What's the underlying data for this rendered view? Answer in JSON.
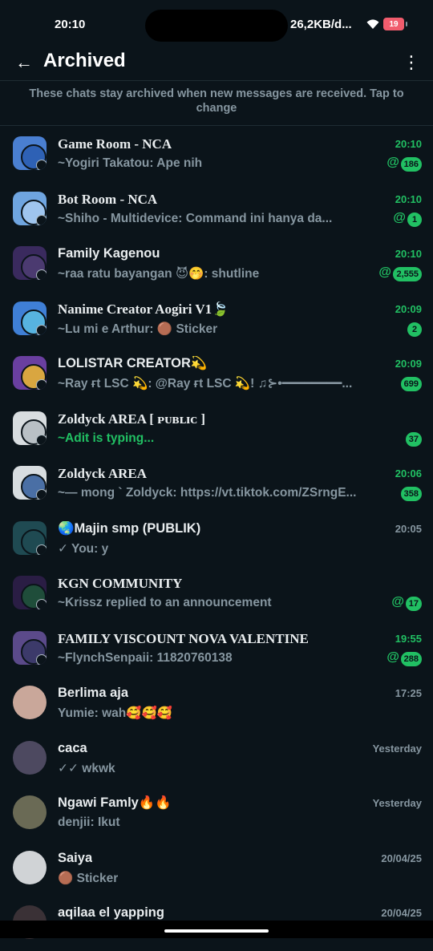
{
  "status": {
    "time": "20:10",
    "speed": "26,2KB/d...",
    "battery": "19"
  },
  "header": {
    "title": "Archived"
  },
  "info_text": "These chats stay archived when new messages are received. Tap to change",
  "chats": [
    {
      "name": "Game Room - NCA",
      "time": "20:10",
      "message": "~Yogiri Takatou: Ape nih",
      "badge": "186",
      "mention": true,
      "time_green": true,
      "serif": true,
      "color": "#4a7fd1",
      "inner": "#2e61b5"
    },
    {
      "name": "Bot Room - NCA",
      "time": "20:10",
      "message": "~Shiho - Multidevice: Command ini hanya da...",
      "badge": "1",
      "mention": true,
      "time_green": true,
      "serif": true,
      "color": "#6fa5e0",
      "inner": "#9fc5ee"
    },
    {
      "name": "Family Kagenou",
      "time": "20:10",
      "message": "~raa ratu bayangan 😈🤭: shutline",
      "badge": "2,555",
      "mention": true,
      "time_green": true,
      "serif": false,
      "color": "#3a2a5e",
      "inner": "#4b3a70"
    },
    {
      "name": "Nanime Creator Aogiri V1🍃",
      "time": "20:09",
      "message": "~Lu mi e Arthur: 🟤 Sticker",
      "badge": "2",
      "mention": false,
      "time_green": true,
      "serif": true,
      "color": "#3f7fd6",
      "inner": "#57b3e0"
    },
    {
      "name": "LOLISTAR CREATOR💫",
      "time": "20:09",
      "message": "~Ray ғt LSC 💫: @Ray ғt LSC 💫! ♫⊱•━━━━━━━━...",
      "badge": "699",
      "mention": false,
      "time_green": true,
      "serif": false,
      "color": "#6a3fa0",
      "inner": "#d9a640"
    },
    {
      "name": "Zoldyck AREA [ ᴘᴜʙʟɪᴄ ]",
      "time": "",
      "message": "~Adit is typing...",
      "badge": "37",
      "mention": false,
      "time_green": false,
      "serif": true,
      "typing": true,
      "color": "#d8dde0",
      "inner": "#b9c0c5"
    },
    {
      "name": "Zoldyck AREA",
      "time": "20:06",
      "message": "~— mong ` Zoldyck: https://vt.tiktok.com/ZSrngE...",
      "badge": "358",
      "mention": false,
      "time_green": true,
      "serif": true,
      "color": "#d8dde0",
      "inner": "#4a6fa5"
    },
    {
      "name": "🌏Majin smp (PUBLIK)",
      "time": "20:05",
      "message": "✓ You: y",
      "badge": "",
      "mention": false,
      "time_green": false,
      "serif": false,
      "color": "#1f4a52",
      "inner": "#1f4a52"
    },
    {
      "name": "KGN COMMUNITY",
      "time": "",
      "message": "~Krissz replied to an announcement",
      "badge": "17",
      "mention": true,
      "time_green": false,
      "serif": true,
      "color": "#2a1d44",
      "inner": "#1f4d3a"
    },
    {
      "name": "FAMILY VISCOUNT NOVA VALENTINE",
      "time": "19:55",
      "message": "~FlynchSenpaii: 11820760138",
      "badge": "288",
      "mention": true,
      "time_green": true,
      "serif": true,
      "color": "#5b4a8a",
      "inner": "#3c3a6a"
    },
    {
      "name": "Berlima aja",
      "time": "17:25",
      "message": "Yumie: wah🥰🥰🥰",
      "badge": "",
      "mention": false,
      "time_green": false,
      "serif": false,
      "color": "#c9a79a",
      "inner": ""
    },
    {
      "name": "caca",
      "time": "Yesterday",
      "message": "✓✓ wkwk",
      "badge": "",
      "mention": false,
      "time_green": false,
      "serif": false,
      "color": "#4d4960",
      "inner": ""
    },
    {
      "name": "Ngawi Famly🔥🔥",
      "time": "Yesterday",
      "message": "denjii: Ikut",
      "badge": "",
      "mention": false,
      "time_green": false,
      "serif": false,
      "color": "#6a6a55",
      "inner": ""
    },
    {
      "name": "Saiya",
      "time": "20/04/25",
      "message": "🟤 Sticker",
      "badge": "",
      "mention": false,
      "time_green": false,
      "serif": false,
      "color": "#d0d3d6",
      "inner": ""
    },
    {
      "name": "aqilaa el yapping",
      "time": "20/04/25",
      "message": "",
      "badge": "",
      "mention": false,
      "time_green": false,
      "serif": false,
      "color": "#3a3136",
      "inner": ""
    }
  ]
}
